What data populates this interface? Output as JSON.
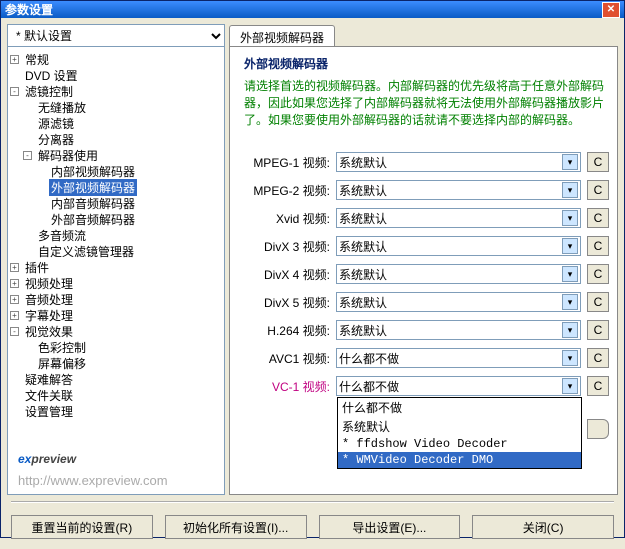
{
  "window": {
    "title": "参数设置"
  },
  "preset": {
    "value": "* 默认设置"
  },
  "tree": {
    "items": [
      {
        "depth": 0,
        "box": "+",
        "label": "常规"
      },
      {
        "depth": 0,
        "box": "",
        "label": "DVD 设置"
      },
      {
        "depth": 0,
        "box": "-",
        "label": "滤镜控制"
      },
      {
        "depth": 1,
        "box": "",
        "label": "无缝播放"
      },
      {
        "depth": 1,
        "box": "",
        "label": "源滤镜"
      },
      {
        "depth": 1,
        "box": "",
        "label": "分离器"
      },
      {
        "depth": 1,
        "box": "-",
        "label": "解码器使用"
      },
      {
        "depth": 2,
        "box": "",
        "label": "内部视频解码器"
      },
      {
        "depth": 2,
        "box": "",
        "label": "外部视频解码器",
        "selected": true
      },
      {
        "depth": 2,
        "box": "",
        "label": "内部音频解码器"
      },
      {
        "depth": 2,
        "box": "",
        "label": "外部音频解码器"
      },
      {
        "depth": 1,
        "box": "",
        "label": "多音频流"
      },
      {
        "depth": 1,
        "box": "",
        "label": "自定义滤镜管理器"
      },
      {
        "depth": 0,
        "box": "+",
        "label": "插件"
      },
      {
        "depth": 0,
        "box": "+",
        "label": "视频处理"
      },
      {
        "depth": 0,
        "box": "+",
        "label": "音频处理"
      },
      {
        "depth": 0,
        "box": "+",
        "label": "字幕处理"
      },
      {
        "depth": 0,
        "box": "-",
        "label": "视觉效果"
      },
      {
        "depth": 1,
        "box": "",
        "label": "色彩控制"
      },
      {
        "depth": 1,
        "box": "",
        "label": "屏幕偏移"
      },
      {
        "depth": 0,
        "box": "",
        "label": "疑难解答"
      },
      {
        "depth": 0,
        "box": "",
        "label": "文件关联"
      },
      {
        "depth": 0,
        "box": "",
        "label": "设置管理"
      }
    ]
  },
  "tab": {
    "label": "外部视频解码器"
  },
  "panel": {
    "title": "外部视频解码器",
    "desc": "请选择首选的视频解码器。内部解码器的优先级将高于任意外部解码器，因此如果您选择了内部解码器就将无法使用外部解码器播放影片了。如果您要使用外部解码器的话就请不要选择内部的解码器。"
  },
  "rows": [
    {
      "label": "MPEG-1 视频:",
      "value": "系统默认"
    },
    {
      "label": "MPEG-2 视频:",
      "value": "系统默认"
    },
    {
      "label": "Xvid 视频:",
      "value": "系统默认"
    },
    {
      "label": "DivX 3 视频:",
      "value": "系统默认"
    },
    {
      "label": "DivX 4 视频:",
      "value": "系统默认"
    },
    {
      "label": "DivX 5 视频:",
      "value": "系统默认"
    },
    {
      "label": "H.264 视频:",
      "value": "系统默认"
    },
    {
      "label": "AVC1 视频:",
      "value": "什么都不做"
    },
    {
      "label": "VC-1 视频:",
      "value": "什么都不做",
      "highlight": true,
      "open": true
    }
  ],
  "c_label": "C",
  "dropdown": {
    "items": [
      {
        "text": "什么都不做"
      },
      {
        "text": "系统默认"
      },
      {
        "text": "* ffdshow Video Decoder"
      },
      {
        "text": "* WMVideo Decoder DMO",
        "hot": true
      }
    ]
  },
  "logo": {
    "url": "http://www.expreview.com"
  },
  "buttons": {
    "reset": "重置当前的设置(R)",
    "init": "初始化所有设置(I)...",
    "export": "导出设置(E)...",
    "close": "关闭(C)"
  }
}
